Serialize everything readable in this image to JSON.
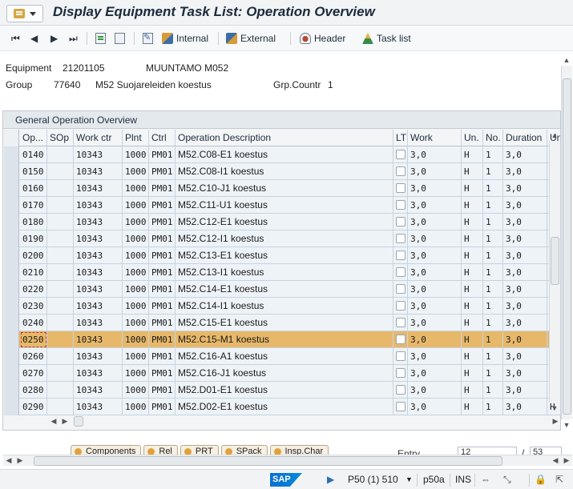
{
  "window": {
    "title": "Display Equipment Task List: Operation Overview"
  },
  "toolbar": {
    "internal_label": "Internal",
    "external_label": "External",
    "header_label": "Header",
    "task_list_label": "Task list"
  },
  "header_info": {
    "equipment_label": "Equipment",
    "equipment_value": "21201105",
    "equipment_desc": "MUUNTAMO M052",
    "group_label": "Group",
    "group_value": "77640",
    "group_desc": "M52 Suojareleiden koestus",
    "grp_countr_label": "Grp.Countr",
    "grp_countr_value": "1"
  },
  "section": {
    "title": "General Operation Overview"
  },
  "table": {
    "columns": [
      "Op...",
      "SOp",
      "Work ctr",
      "Plnt",
      "Ctrl",
      "Operation Description",
      "LT",
      "Work",
      "Un.",
      "No.",
      "Duration",
      "Un."
    ],
    "rows": [
      {
        "op": "0140",
        "sop": "",
        "work_ctr": "10343",
        "plnt": "1000",
        "ctrl": "PM01",
        "desc": "M52.C08-E1 koestus",
        "work": "3,0",
        "un": "H",
        "no": "1",
        "duration": "3,0",
        "un2": "H"
      },
      {
        "op": "0150",
        "sop": "",
        "work_ctr": "10343",
        "plnt": "1000",
        "ctrl": "PM01",
        "desc": "M52.C08-I1 koestus",
        "work": "3,0",
        "un": "H",
        "no": "1",
        "duration": "3,0",
        "un2": "H"
      },
      {
        "op": "0160",
        "sop": "",
        "work_ctr": "10343",
        "plnt": "1000",
        "ctrl": "PM01",
        "desc": "M52.C10-J1 koestus",
        "work": "3,0",
        "un": "H",
        "no": "1",
        "duration": "3,0",
        "un2": "H"
      },
      {
        "op": "0170",
        "sop": "",
        "work_ctr": "10343",
        "plnt": "1000",
        "ctrl": "PM01",
        "desc": "M52.C11-U1 koestus",
        "work": "3,0",
        "un": "H",
        "no": "1",
        "duration": "3,0",
        "un2": "H"
      },
      {
        "op": "0180",
        "sop": "",
        "work_ctr": "10343",
        "plnt": "1000",
        "ctrl": "PM01",
        "desc": "M52.C12-E1 koestus",
        "work": "3,0",
        "un": "H",
        "no": "1",
        "duration": "3,0",
        "un2": "H"
      },
      {
        "op": "0190",
        "sop": "",
        "work_ctr": "10343",
        "plnt": "1000",
        "ctrl": "PM01",
        "desc": "M52.C12-I1 koestus",
        "work": "3,0",
        "un": "H",
        "no": "1",
        "duration": "3,0",
        "un2": "H"
      },
      {
        "op": "0200",
        "sop": "",
        "work_ctr": "10343",
        "plnt": "1000",
        "ctrl": "PM01",
        "desc": "M52.C13-E1 koestus",
        "work": "3,0",
        "un": "H",
        "no": "1",
        "duration": "3,0",
        "un2": "H"
      },
      {
        "op": "0210",
        "sop": "",
        "work_ctr": "10343",
        "plnt": "1000",
        "ctrl": "PM01",
        "desc": "M52.C13-I1 koestus",
        "work": "3,0",
        "un": "H",
        "no": "1",
        "duration": "3,0",
        "un2": "H"
      },
      {
        "op": "0220",
        "sop": "",
        "work_ctr": "10343",
        "plnt": "1000",
        "ctrl": "PM01",
        "desc": "M52.C14-E1 koestus",
        "work": "3,0",
        "un": "H",
        "no": "1",
        "duration": "3,0",
        "un2": "H"
      },
      {
        "op": "0230",
        "sop": "",
        "work_ctr": "10343",
        "plnt": "1000",
        "ctrl": "PM01",
        "desc": "M52.C14-I1 koestus",
        "work": "3,0",
        "un": "H",
        "no": "1",
        "duration": "3,0",
        "un2": "H"
      },
      {
        "op": "0240",
        "sop": "",
        "work_ctr": "10343",
        "plnt": "1000",
        "ctrl": "PM01",
        "desc": "M52.C15-E1 koestus",
        "work": "3,0",
        "un": "H",
        "no": "1",
        "duration": "3,0",
        "un2": "H"
      },
      {
        "op": "0250",
        "sop": "",
        "work_ctr": "10343",
        "plnt": "1000",
        "ctrl": "PM01",
        "desc": "M52.C15-M1 koestus",
        "work": "3,0",
        "un": "H",
        "no": "1",
        "duration": "3,0",
        "un2": "H",
        "selected": true
      },
      {
        "op": "0260",
        "sop": "",
        "work_ctr": "10343",
        "plnt": "1000",
        "ctrl": "PM01",
        "desc": "M52.C16-A1 koestus",
        "work": "3,0",
        "un": "H",
        "no": "1",
        "duration": "3,0",
        "un2": "H"
      },
      {
        "op": "0270",
        "sop": "",
        "work_ctr": "10343",
        "plnt": "1000",
        "ctrl": "PM01",
        "desc": "M52.C16-J1 koestus",
        "work": "3,0",
        "un": "H",
        "no": "1",
        "duration": "3,0",
        "un2": "H"
      },
      {
        "op": "0280",
        "sop": "",
        "work_ctr": "10343",
        "plnt": "1000",
        "ctrl": "PM01",
        "desc": "M52.D01-E1 koestus",
        "work": "3,0",
        "un": "H",
        "no": "1",
        "duration": "3,0",
        "un2": "H"
      },
      {
        "op": "0290",
        "sop": "",
        "work_ctr": "10343",
        "plnt": "1000",
        "ctrl": "PM01",
        "desc": "M52.D02-E1 koestus",
        "work": "3,0",
        "un": "H",
        "no": "1",
        "duration": "3,0",
        "un2": "H"
      }
    ]
  },
  "bottom_buttons": {
    "buttons": [
      "Components",
      "Rel",
      "PRT",
      "SPack",
      "Insp.Char"
    ],
    "entry_label": "Entry",
    "entry_value": "12",
    "entry_total": "53"
  },
  "status_bar": {
    "logo_text": "SAP",
    "system": "P50 (1) 510",
    "server": "p50a",
    "mode": "INS"
  },
  "colors": {
    "selected_row": "#e7b86a",
    "row_bg": "#eef3f8",
    "title_text": "#1b2a3a"
  },
  "icons": [
    "menu-icon",
    "first-page-icon",
    "previous-page-icon",
    "next-page-icon",
    "last-page-icon",
    "select-all-icon",
    "deselect-all-icon",
    "edit-icon",
    "internal-icon",
    "external-icon",
    "header-icon",
    "task-list-icon"
  ]
}
